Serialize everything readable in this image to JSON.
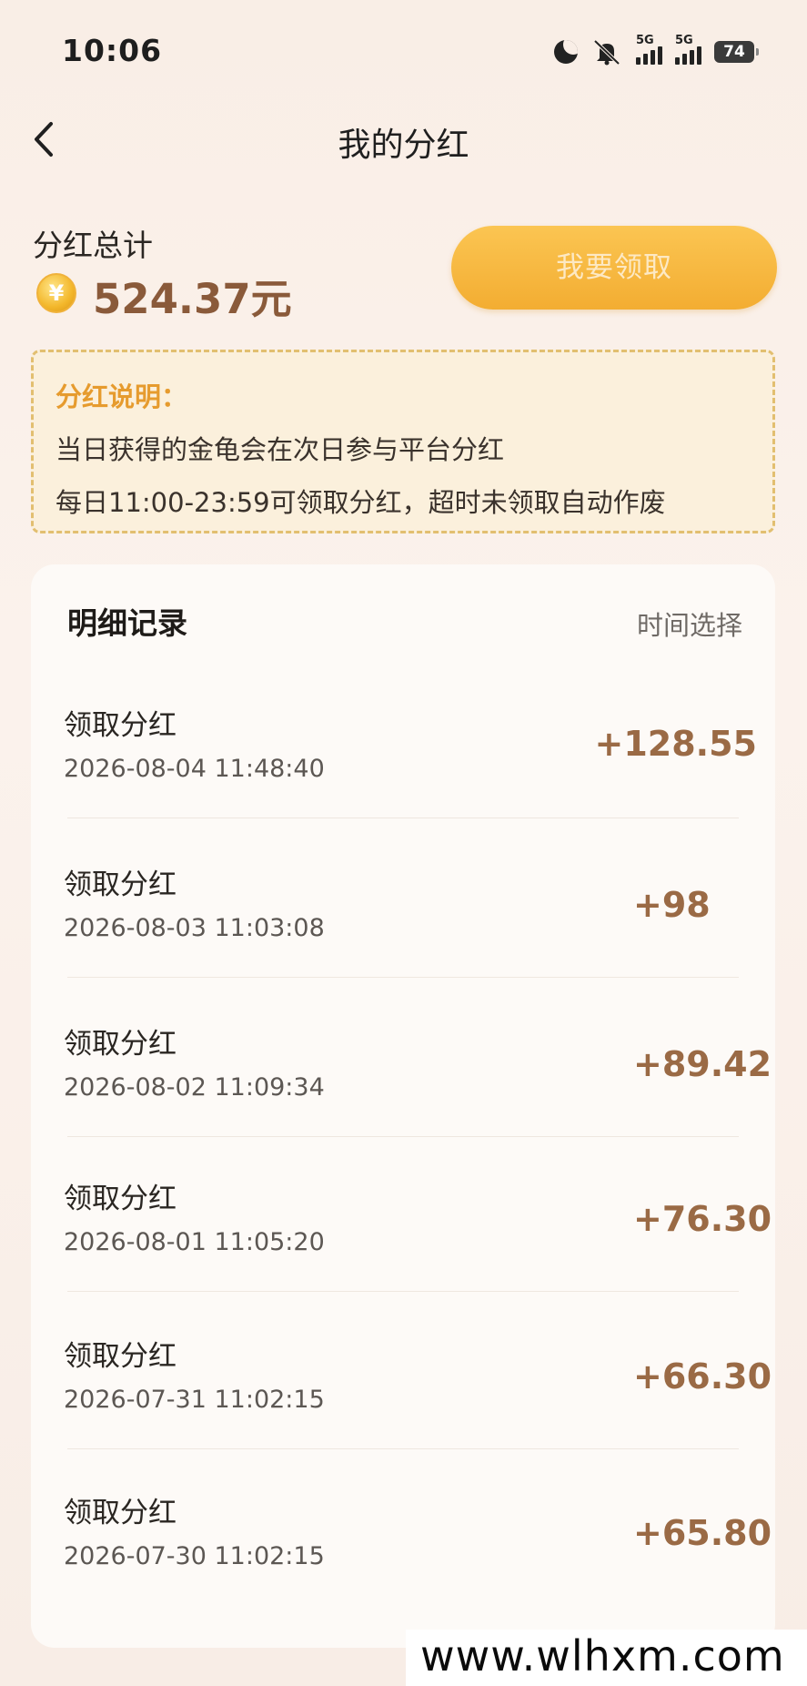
{
  "status_bar": {
    "time": "10:06",
    "signal_1_label": "5G",
    "signal_2_label": "5G",
    "battery_level": "74"
  },
  "nav": {
    "title": "我的分红"
  },
  "summary": {
    "label": "分红总计",
    "coin_symbol": "¥",
    "amount": "524.37元",
    "claim_button_label": "我要领取"
  },
  "notice": {
    "title": "分红说明：",
    "line1": "当日获得的金龟会在次日参与平台分红",
    "line2": "每日11:00-23:59可领取分红，超时未领取自动作废"
  },
  "detail": {
    "title": "明细记录",
    "time_select_label": "时间选择",
    "records": [
      {
        "label": "领取分红",
        "time": "2026-08-04 11:48:40",
        "amount": "+128.55"
      },
      {
        "label": "领取分红",
        "time": "2026-08-03 11:03:08",
        "amount": "+98"
      },
      {
        "label": "领取分红",
        "time": "2026-08-02 11:09:34",
        "amount": "+89.42"
      },
      {
        "label": "领取分红",
        "time": "2026-08-01 11:05:20",
        "amount": "+76.30"
      },
      {
        "label": "领取分红",
        "time": "2026-07-31 11:02:15",
        "amount": "+66.30"
      },
      {
        "label": "领取分红",
        "time": "2026-07-30 11:02:15",
        "amount": "+65.80"
      }
    ]
  },
  "watermark": "www.wlhxm.com",
  "colors": {
    "accent": "#f3ad32",
    "amount": "#9a6a45",
    "notice_title": "#e69b2e"
  }
}
